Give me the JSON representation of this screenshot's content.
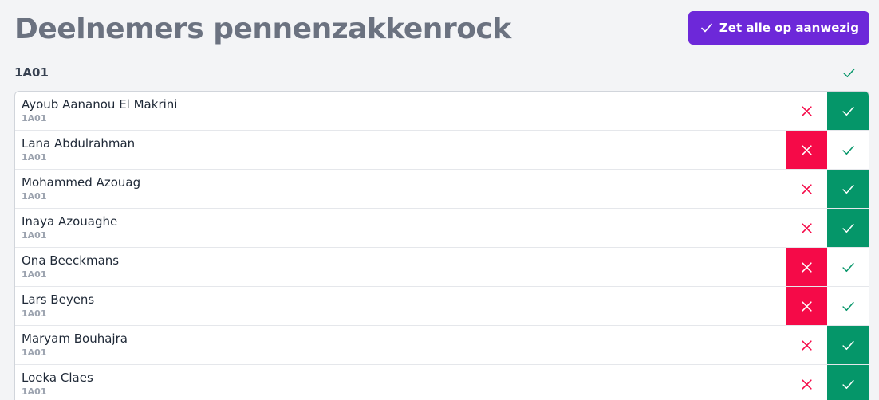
{
  "header": {
    "title": "Deelnemers pennenzakkenrock",
    "mark_all_label": "Zet alle op aanwezig"
  },
  "group": {
    "label": "1A01"
  },
  "colors": {
    "accent": "#6d28d9",
    "present": "#059669",
    "absent": "#f50a48"
  },
  "participants": [
    {
      "name": "Ayoub Aananou El Makrini",
      "class": "1A01",
      "status": "present"
    },
    {
      "name": "Lana Abdulrahman",
      "class": "1A01",
      "status": "absent"
    },
    {
      "name": "Mohammed Azouag",
      "class": "1A01",
      "status": "present"
    },
    {
      "name": "Inaya Azouaghe",
      "class": "1A01",
      "status": "present"
    },
    {
      "name": "Ona Beeckmans",
      "class": "1A01",
      "status": "absent"
    },
    {
      "name": "Lars Beyens",
      "class": "1A01",
      "status": "absent"
    },
    {
      "name": "Maryam Bouhajra",
      "class": "1A01",
      "status": "present"
    },
    {
      "name": "Loeka Claes",
      "class": "1A01",
      "status": "present"
    }
  ]
}
